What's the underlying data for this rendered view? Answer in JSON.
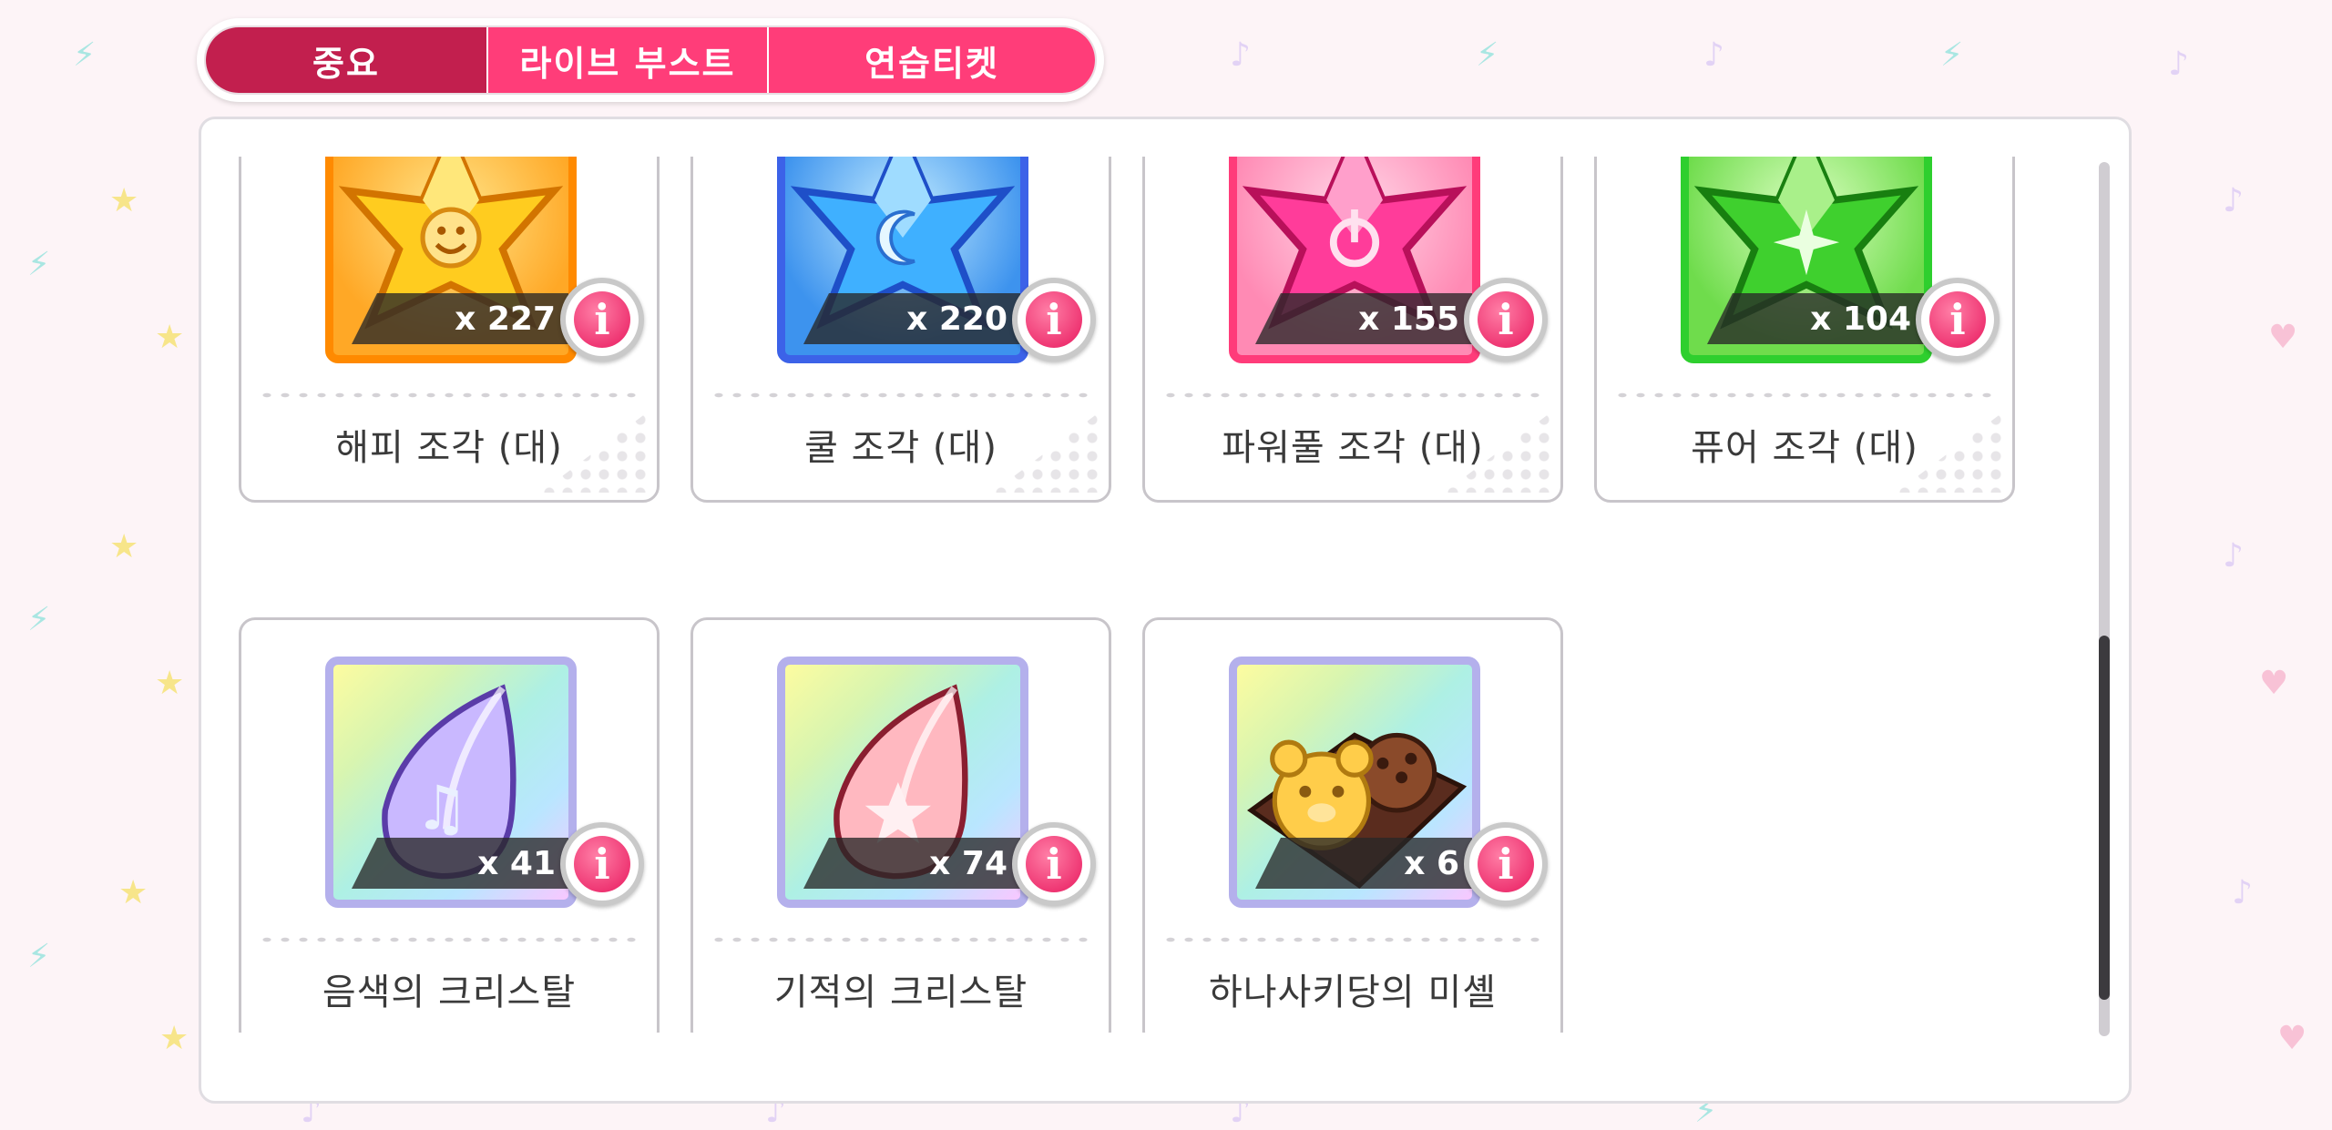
{
  "tabs": [
    {
      "label": "중요",
      "active": true
    },
    {
      "label": "라이브 부스트",
      "active": false
    },
    {
      "label": "연습티켓",
      "active": false
    }
  ],
  "items": [
    {
      "name": "해피 조각 (대)",
      "quantity": "x 227",
      "icon": "happy-star-shard-icon"
    },
    {
      "name": "쿨 조각 (대)",
      "quantity": "x 220",
      "icon": "cool-star-shard-icon"
    },
    {
      "name": "파워풀 조각 (대)",
      "quantity": "x 155",
      "icon": "powerful-star-shard-icon"
    },
    {
      "name": "퓨어 조각 (대)",
      "quantity": "x 104",
      "icon": "pure-star-shard-icon"
    },
    {
      "name": "음색의 크리스탈",
      "quantity": "x 41",
      "icon": "tone-crystal-icon"
    },
    {
      "name": "기적의 크리스탈",
      "quantity": "x 74",
      "icon": "miracle-crystal-icon"
    },
    {
      "name": "하나사키당의 미셸",
      "quantity": "x 6",
      "icon": "michelle-cookie-icon"
    }
  ],
  "info_glyph": "i",
  "colors": {
    "tab_active": "#c21f4e",
    "tab_inactive": "#ff3d79",
    "happy": "#ff8a00",
    "cool": "#3c62e8",
    "power": "#ff3c7a",
    "pure": "#2ecf2e"
  }
}
